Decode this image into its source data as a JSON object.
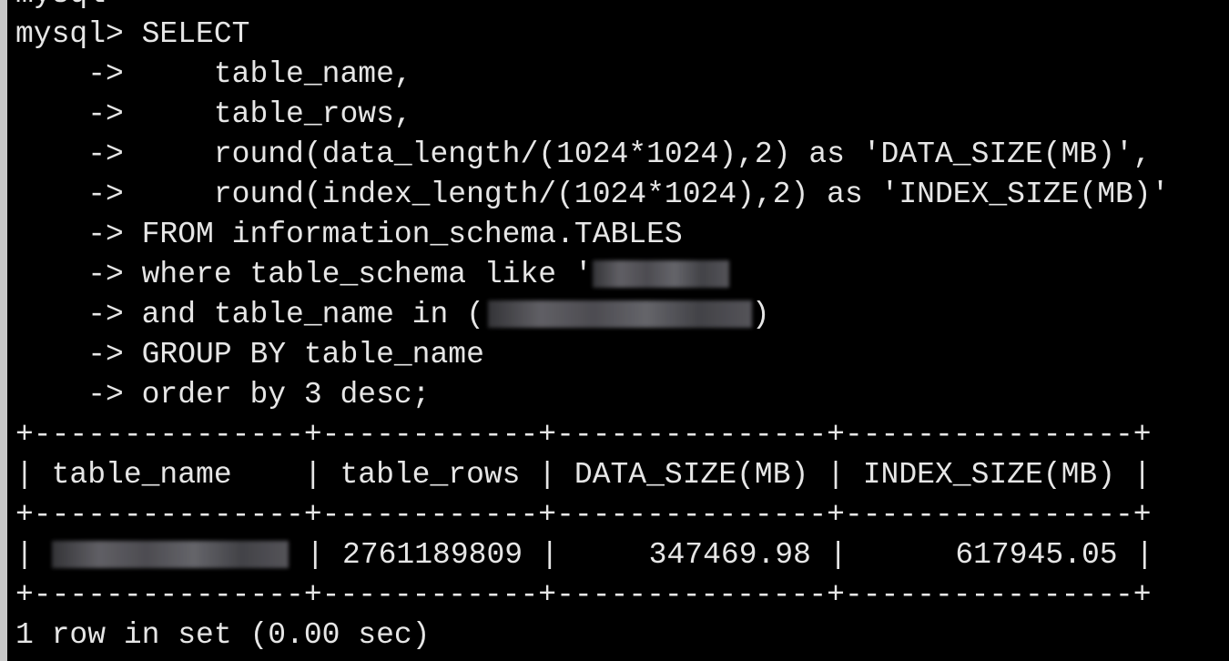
{
  "terminal": {
    "lines": [
      "mysql>",
      "mysql> SELECT",
      "    ->     table_name,",
      "    ->     table_rows,",
      "    ->     round(data_length/(1024*1024),2) as 'DATA_SIZE(MB)',",
      "    ->     round(index_length/(1024*1024),2) as 'INDEX_SIZE(MB)'",
      "    -> FROM information_schema.TABLES",
      "    -> where table_schema like '",
      "    -> and table_name in (",
      ")",
      "    -> GROUP BY table_name",
      "    -> order by 3 desc;",
      "+---------------+------------+---------------+----------------+",
      "| table_name    | table_rows | DATA_SIZE(MB) | INDEX_SIZE(MB) |",
      "+---------------+------------+---------------+----------------+",
      "| ",
      " | 2761189809 |     347469.98 |      617945.05 |",
      "+---------------+------------+---------------+----------------+",
      "1 row in set (0.00 sec)"
    ]
  }
}
